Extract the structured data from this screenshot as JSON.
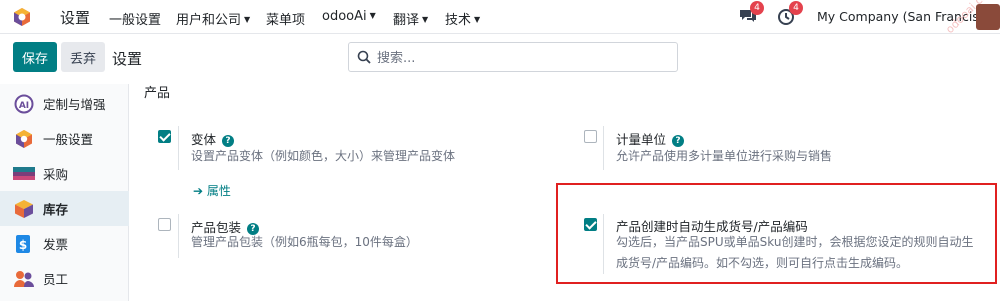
{
  "app": {
    "title": "设置"
  },
  "nav": {
    "items": [
      {
        "label": "一般设置",
        "dropdown": false
      },
      {
        "label": "用户和公司",
        "dropdown": true
      },
      {
        "label": "菜单项",
        "dropdown": false
      },
      {
        "label": "odooAi",
        "dropdown": true
      },
      {
        "label": "翻译",
        "dropdown": true
      },
      {
        "label": "技术",
        "dropdown": true
      }
    ],
    "messages_badge": "4",
    "activities_badge": "4",
    "company": "My Company (San Francisco)",
    "watermark": "odooai.cn"
  },
  "control": {
    "save_label": "保存",
    "discard_label": "丢弃",
    "title": "设置",
    "search_placeholder": "搜索..."
  },
  "sidebar": {
    "items": [
      {
        "label": "定制与增强",
        "icon": "ai-icon",
        "active": false
      },
      {
        "label": "一般设置",
        "icon": "odoo-logo-icon",
        "active": false
      },
      {
        "label": "采购",
        "icon": "purchase-icon",
        "active": false
      },
      {
        "label": "库存",
        "icon": "inventory-icon",
        "active": true
      },
      {
        "label": "发票",
        "icon": "invoicing-icon",
        "active": false
      },
      {
        "label": "员工",
        "icon": "employees-icon",
        "active": false
      }
    ]
  },
  "main": {
    "section_title": "产品",
    "settings": [
      {
        "title": "变体",
        "checked": true,
        "help": true,
        "desc": "设置产品变体（例如颜色，大小）来管理产品变体",
        "link": "属性"
      },
      {
        "title": "计量单位",
        "checked": false,
        "help": true,
        "desc": "允许产品使用多计量单位进行采购与销售"
      },
      {
        "title": "产品包装",
        "checked": false,
        "help": true,
        "desc": "管理产品包装（例如6瓶每包，10件每盒）"
      },
      {
        "title": "产品创建时自动生成货号/产品编码",
        "checked": true,
        "help": false,
        "desc_line1": "勾选后，当产品SPU或单品Sku创建时，会根据您设定的规则自动生",
        "desc_line2": "成货号/产品编码。如不勾选，则可自行点击生成编码。"
      }
    ]
  },
  "colors": {
    "accent": "#017e84",
    "badge": "#e4424d",
    "highlight": "#e02020"
  }
}
